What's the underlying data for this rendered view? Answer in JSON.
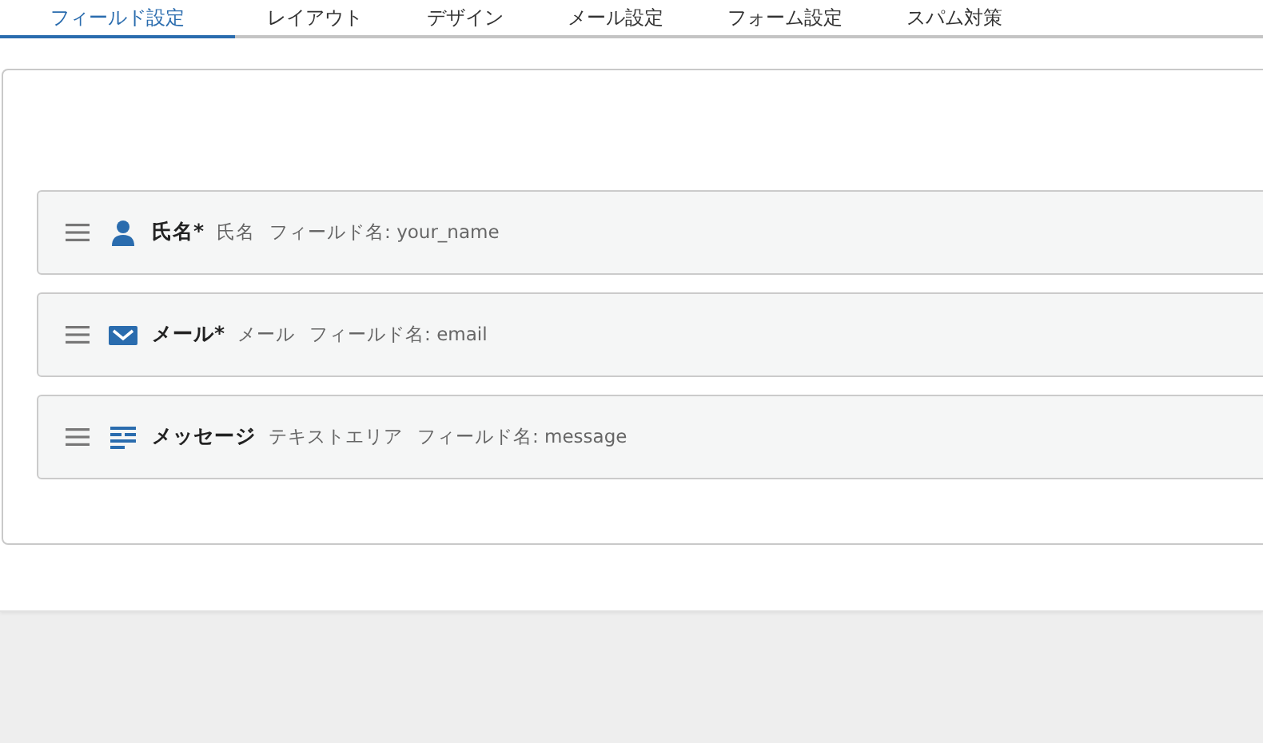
{
  "tabs": [
    {
      "label": "フィールド設定",
      "selected": true
    },
    {
      "label": "レイアウト",
      "selected": false
    },
    {
      "label": "デザイン",
      "selected": false
    },
    {
      "label": "メール設定",
      "selected": false
    },
    {
      "label": "フォーム設定",
      "selected": false
    },
    {
      "label": "スパム対策",
      "selected": false
    }
  ],
  "fields": [
    {
      "kind": "person",
      "label": "氏名*",
      "type": "氏名",
      "field_name": "フィールド名: your_name"
    },
    {
      "kind": "mail",
      "label": "メール*",
      "type": "メール",
      "field_name": "フィールド名: email"
    },
    {
      "kind": "textarea",
      "label": "メッセージ",
      "type": "テキストエリア",
      "field_name": "フィールド名: message"
    }
  ]
}
